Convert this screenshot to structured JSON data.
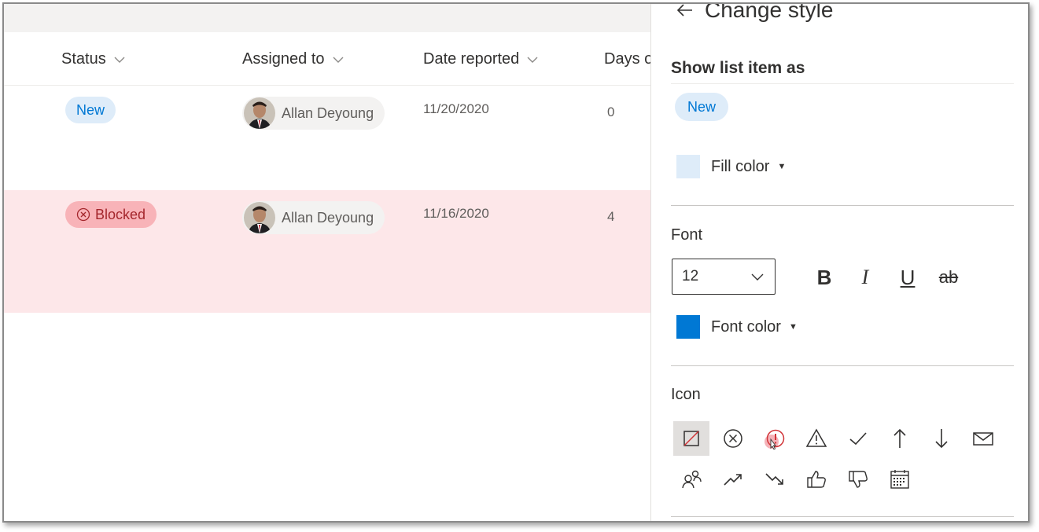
{
  "list": {
    "columns": [
      "Status",
      "Assigned to",
      "Date reported",
      "Days o"
    ],
    "rows": [
      {
        "status": "New",
        "assigned": "Allan Deyoung",
        "date": "11/20/2020",
        "days": "0"
      },
      {
        "status": "Blocked",
        "assigned": "Allan Deyoung",
        "date": "11/16/2020",
        "days": "4"
      }
    ]
  },
  "panel": {
    "title": "Change style",
    "show_as_label": "Show list item as",
    "preview_text": "New",
    "fill_color_label": "Fill color",
    "font_section_label": "Font",
    "font_size": "12",
    "bold_label": "B",
    "italic_label": "I",
    "underline_label": "U",
    "strike_label": "ab",
    "font_color_label": "Font color",
    "icon_section_label": "Icon",
    "icons": [
      "none-icon",
      "circle-x-icon",
      "alert-circle-icon",
      "warning-icon",
      "check-icon",
      "arrow-up-icon",
      "arrow-down-icon",
      "mail-icon",
      "people-icon",
      "trending-up-icon",
      "trending-down-icon",
      "thumbs-up-icon",
      "thumbs-down-icon",
      "calendar-icon"
    ]
  },
  "colors": {
    "fill_color": "#deecf9",
    "font_color": "#0078d4",
    "blocked_row": "#fde7e9",
    "blocked_pill": "#f8b3b8"
  }
}
